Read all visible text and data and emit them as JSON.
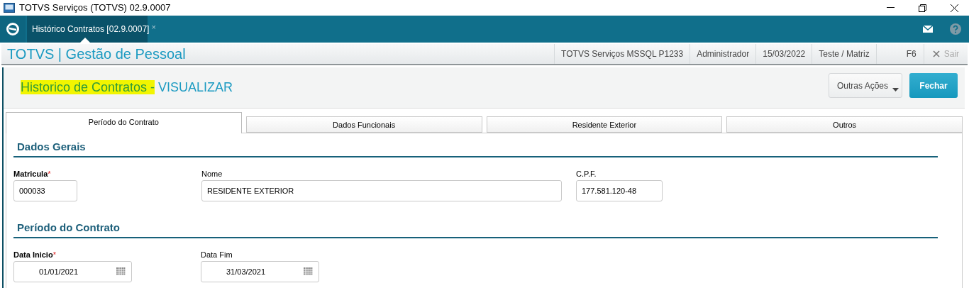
{
  "window": {
    "title": "TOTVS Serviços (TOTVS) 02.9.0007"
  },
  "app_tabs": [
    {
      "label": "Histórico Contratos [02.9.0007]",
      "close": "×",
      "selected": true
    }
  ],
  "header": {
    "product": "TOTVS | Gestão de Pessoal",
    "info": [
      "TOTVS Serviços MSSQL P1233",
      "Administrador",
      "15/03/2022",
      "Teste / Matriz",
      "F6"
    ],
    "exit": "Sair"
  },
  "page_title": {
    "name": "Historico de Contratos -",
    "mode": "VISUALIZAR",
    "highlighted": true
  },
  "actions": [
    {
      "label": "Outras Ações",
      "kind": "menu"
    },
    {
      "label": "Fechar",
      "kind": "primary"
    }
  ],
  "tabs": [
    {
      "label": "Período do Contrato",
      "selected": true
    },
    {
      "label": "Dados Funcionais",
      "selected": false
    },
    {
      "label": "Residente Exterior",
      "selected": false
    },
    {
      "label": "Outros",
      "selected": false
    }
  ],
  "sections": [
    {
      "title": "Dados Gerais",
      "fields": [
        {
          "label": "Matricula",
          "required_mark": "*",
          "value": "000033",
          "kind": "text"
        },
        {
          "label": "Nome",
          "value": "RESIDENTE EXTERIOR",
          "kind": "text"
        },
        {
          "label": "C.P.F.",
          "value": "177.581.120-48",
          "kind": "text"
        }
      ]
    },
    {
      "title": "Período do Contrato",
      "fields": [
        {
          "label": "Data Inicio",
          "required_mark": "*",
          "value": "01/01/2021",
          "kind": "date"
        },
        {
          "label": "Data Fim",
          "value": "31/03/2021",
          "kind": "date"
        }
      ]
    }
  ]
}
